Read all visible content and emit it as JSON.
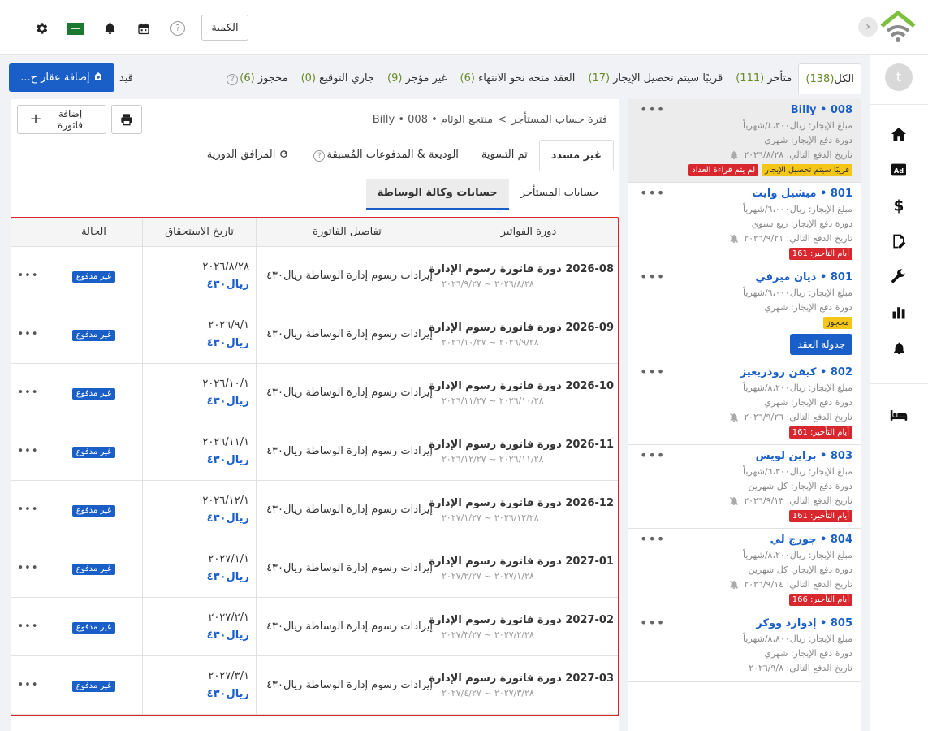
{
  "header": {
    "quantity_label": "الكمية",
    "help_glyph": "?"
  },
  "status_tabs": [
    {
      "label": "الكل",
      "count": "(138)"
    },
    {
      "label": "متأخر",
      "count": "(111)"
    },
    {
      "label": "قريبًا سيتم تحصيل الإيجار",
      "count": "(17)"
    },
    {
      "label": "العقد متجه نحو الانتهاء",
      "count": "(6)"
    },
    {
      "label": "غير مؤجر",
      "count": "(9)"
    },
    {
      "label": "جاري التوقيع",
      "count": "(0)"
    },
    {
      "label": "محجوز",
      "count": "(6)"
    }
  ],
  "status_tab_cut": "قيد",
  "add_property_label": "إضافة عقار ج...",
  "rail": {
    "avatar_letter": "t"
  },
  "units": [
    {
      "name": "Billy",
      "num": "008",
      "rent": "مبلغ الإيجار: ريال٤،٣٠٠/شهرياً",
      "cycle": "دورة دفع الإيجار: شهري",
      "next": "تاريخ الدفع التالي: ٢٠٢٦/٨/٢٨",
      "badge_red": "لم يتم قراءة العداد",
      "badge_yellow": "قريبًا سيتم تحصيل الإيجار"
    },
    {
      "name": "ميشيل وايت",
      "num": "801",
      "rent": "مبلغ الإيجار: ريال٦،٠٠٠/شهرياً",
      "cycle": "دورة دفع الإيجار: ربع سنوي",
      "next": "تاريخ الدفع التالي: ٢٠٢٦/٩/٢١",
      "badge_red": "أيام التأخير: 161"
    },
    {
      "name": "ديان ميرفي",
      "num": "801",
      "rent": "مبلغ الإيجار: ريال٦،٠٠٠/شهرياً",
      "cycle": "دورة دفع الإيجار: شهري",
      "badge_yellow": "محجوز",
      "button": "جدولة العقد"
    },
    {
      "name": "كيفن رودريغيز",
      "num": "802",
      "rent": "مبلغ الإيجار: ريال٨،٢٠٠/شهرياً",
      "cycle": "دورة دفع الإيجار: شهري",
      "next": "تاريخ الدفع التالي: ٢٠٢٦/٩/٢٦",
      "badge_red": "أيام التأخير: 161"
    },
    {
      "name": "براين لويس",
      "num": "803",
      "rent": "مبلغ الإيجار: ريال٦،٣٠٠/شهرياً",
      "cycle": "دورة دفع الإيجار: كل شهرين",
      "next": "تاريخ الدفع التالي: ٢٠٢٦/٩/١٣",
      "badge_red": "أيام التأخير: 161"
    },
    {
      "name": "جورج لي",
      "num": "804",
      "rent": "مبلغ الإيجار: ريال٨،٢٠٠/شهرياً",
      "cycle": "دورة دفع الإيجار: كل شهرين",
      "next": "تاريخ الدفع التالي: ٢٠٢٦/٩/١٤",
      "badge_red": "أيام التأخير: 166"
    },
    {
      "name": "إدوارد ووكر",
      "num": "805",
      "rent": "مبلغ الإيجار: ريال٨،٨٠٠/شهرياً",
      "cycle": "دورة دفع الإيجار: شهري",
      "next": "تاريخ الدفع التالي: ٢٠٢٦/٩/٨"
    }
  ],
  "breadcrumb": {
    "root": "فترة حساب المستأجر",
    "path": "منتجع الوئام • 008 • Billy",
    "sep": ">"
  },
  "add_invoice_label": "إضافة فاتورة",
  "main_tabs": [
    {
      "label": "غير مسدد"
    },
    {
      "label": "تم التسوية"
    },
    {
      "label": "الوديعة & المدفوعات المُسبقة"
    },
    {
      "label": "المرافق الدورية"
    }
  ],
  "sub_tabs": [
    "حسابات المستأجر",
    "حسابات وكالة الوساطة"
  ],
  "table": {
    "headers": [
      "دورة الفواتير",
      "تفاصيل الفاتورة",
      "تاريخ الاستحقاق",
      "الحالة",
      ""
    ],
    "rows": [
      {
        "cycle": "2026-08 دورة فاتورة رسوم الإدارة",
        "range": "٢٠٢٦/٨/٢٨ ~ ٢٠٢٦/٩/٢٧",
        "detail": "إيرادات رسوم إدارة الوساطة  ريال٤٣٠",
        "due": "٢٠٢٦/٨/٢٨",
        "amount": "ريال٤٣٠",
        "status": "غير مدفوع"
      },
      {
        "cycle": "2026-09 دورة فاتورة رسوم الإدارة",
        "range": "٢٠٢٦/٩/٢٨ ~ ٢٠٢٦/١٠/٢٧",
        "detail": "إيرادات رسوم إدارة الوساطة  ريال٤٣٠",
        "due": "٢٠٢٦/٩/١",
        "amount": "ريال٤٣٠",
        "status": "غير مدفوع"
      },
      {
        "cycle": "2026-10 دورة فاتورة رسوم الإدارة",
        "range": "٢٠٢٦/١٠/٢٨ ~ ٢٠٢٦/١١/٢٧",
        "detail": "إيرادات رسوم إدارة الوساطة  ريال٤٣٠",
        "due": "٢٠٢٦/١٠/١",
        "amount": "ريال٤٣٠",
        "status": "غير مدفوع"
      },
      {
        "cycle": "2026-11 دورة فاتورة رسوم الإدارة",
        "range": "٢٠٢٦/١١/٢٨ ~ ٢٠٢٦/١٢/٢٧",
        "detail": "إيرادات رسوم إدارة الوساطة  ريال٤٣٠",
        "due": "٢٠٢٦/١١/١",
        "amount": "ريال٤٣٠",
        "status": "غير مدفوع"
      },
      {
        "cycle": "2026-12 دورة فاتورة رسوم الإدارة",
        "range": "٢٠٢٦/١٢/٢٨ ~ ٢٠٢٧/١/٢٧",
        "detail": "إيرادات رسوم إدارة الوساطة  ريال٤٣٠",
        "due": "٢٠٢٦/١٢/١",
        "amount": "ريال٤٣٠",
        "status": "غير مدفوع"
      },
      {
        "cycle": "2027-01 دورة فاتورة رسوم الإدارة",
        "range": "٢٠٢٧/١/٢٨ ~ ٢٠٢٧/٢/٢٧",
        "detail": "إيرادات رسوم إدارة الوساطة  ريال٤٣٠",
        "due": "٢٠٢٧/١/١",
        "amount": "ريال٤٣٠",
        "status": "غير مدفوع"
      },
      {
        "cycle": "2027-02 دورة فاتورة رسوم الإدارة",
        "range": "٢٠٢٧/٢/٢٨ ~ ٢٠٢٧/٣/٢٧",
        "detail": "إيرادات رسوم إدارة الوساطة  ريال٤٣٠",
        "due": "٢٠٢٧/٢/١",
        "amount": "ريال٤٣٠",
        "status": "غير مدفوع"
      },
      {
        "cycle": "2027-03 دورة فاتورة رسوم الإدارة",
        "range": "٢٠٢٧/٣/٢٨ ~ ٢٠٢٧/٤/٢٧",
        "detail": "إيرادات رسوم إدارة الوساطة  ريال٤٣٠",
        "due": "٢٠٢٧/٣/١",
        "amount": "ريال٤٣٠",
        "status": "غير مدفوع"
      }
    ],
    "row_more_glyph": "•••"
  },
  "colors": {
    "accent": "#1a5fc8",
    "danger": "#d9272e",
    "warning": "#f5c518",
    "count_green": "#6a8a2b"
  }
}
